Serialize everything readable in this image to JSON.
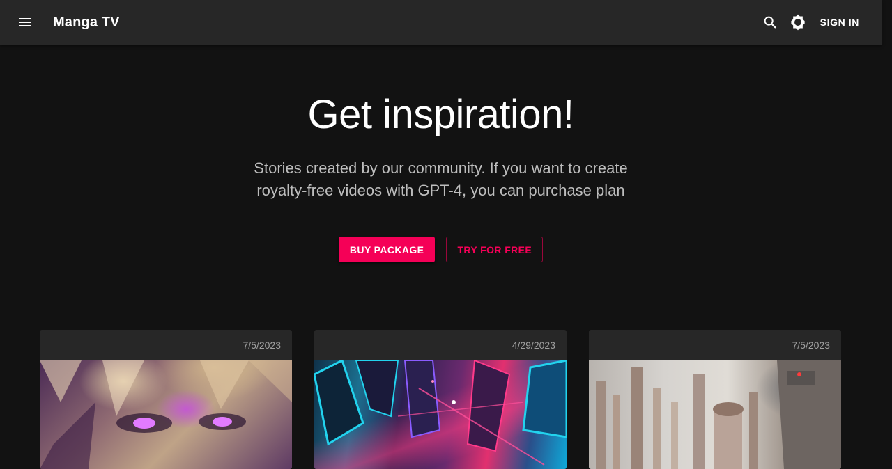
{
  "app": {
    "title": "Manga TV"
  },
  "header": {
    "menu_icon": "menu-icon",
    "search_icon": "search-icon",
    "theme_icon": "brightness-icon",
    "signin_label": "SIGN IN"
  },
  "hero": {
    "title": "Get inspiration!",
    "subtitle": "Stories created by our community. If you want to create royalty-free videos with GPT-4, you can purchase plan",
    "primary_button": "BUY PACKAGE",
    "secondary_button": "TRY FOR FREE"
  },
  "cards": [
    {
      "date": "7/5/2023",
      "thumbnail": "anime-character-thumbnail"
    },
    {
      "date": "4/29/2023",
      "thumbnail": "neon-city-thumbnail"
    },
    {
      "date": "7/5/2023",
      "thumbnail": "futuristic-city-thumbnail"
    }
  ],
  "colors": {
    "accent": "#f50057",
    "appbar_bg": "#272727",
    "page_bg": "#121212",
    "card_bg": "#272727"
  }
}
